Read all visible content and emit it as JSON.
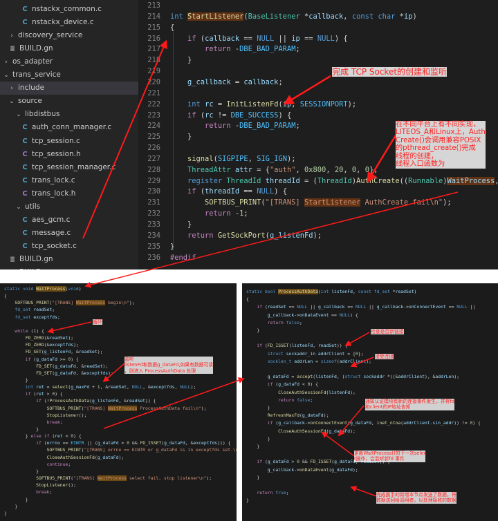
{
  "sidebar": {
    "items": [
      {
        "label": "nstackx_common.c",
        "icon": "c-file-icon",
        "glyph": "C",
        "kind": "c"
      },
      {
        "label": "nstackx_device.c",
        "icon": "c-file-icon",
        "glyph": "C",
        "kind": "c"
      },
      {
        "label": "discovery_service",
        "icon": "chevron-right-icon",
        "glyph": "›",
        "kind": "folder"
      },
      {
        "label": "BUILD.gn",
        "icon": "gn-file-icon",
        "glyph": "≣",
        "kind": "gn"
      },
      {
        "label": "os_adapter",
        "icon": "chevron-right-icon",
        "glyph": "›",
        "kind": "folder"
      },
      {
        "label": "trans_service",
        "icon": "chevron-down-icon",
        "glyph": "⌄",
        "kind": "folder"
      },
      {
        "label": "include",
        "icon": "chevron-right-icon",
        "glyph": "›",
        "kind": "folder"
      },
      {
        "label": "source",
        "icon": "chevron-down-icon",
        "glyph": "⌄",
        "kind": "folder"
      },
      {
        "label": "libdistbus",
        "icon": "chevron-down-icon",
        "glyph": "⌄",
        "kind": "folder"
      },
      {
        "label": "auth_conn_manager.c",
        "icon": "c-file-icon",
        "glyph": "C",
        "kind": "c"
      },
      {
        "label": "tcp_session.c",
        "icon": "c-file-icon",
        "glyph": "C",
        "kind": "c"
      },
      {
        "label": "tcp_session.h",
        "icon": "h-file-icon",
        "glyph": "C",
        "kind": "h"
      },
      {
        "label": "tcp_session_manager.c",
        "icon": "c-file-icon",
        "glyph": "C",
        "kind": "c"
      },
      {
        "label": "trans_lock.c",
        "icon": "c-file-icon",
        "glyph": "C",
        "kind": "c"
      },
      {
        "label": "trans_lock.h",
        "icon": "h-file-icon",
        "glyph": "C",
        "kind": "h"
      },
      {
        "label": "utils",
        "icon": "chevron-down-icon",
        "glyph": "⌄",
        "kind": "folder"
      },
      {
        "label": "aes_gcm.c",
        "icon": "c-file-icon",
        "glyph": "C",
        "kind": "c"
      },
      {
        "label": "message.c",
        "icon": "c-file-icon",
        "glyph": "C",
        "kind": "c"
      },
      {
        "label": "tcp_socket.c",
        "icon": "c-file-icon",
        "glyph": "C",
        "kind": "c"
      },
      {
        "label": "BUILD.gn",
        "icon": "gn-file-icon",
        "glyph": "≣",
        "kind": "gn"
      },
      {
        "label": "BUILD.gn",
        "icon": "gn-file-icon",
        "glyph": "≣",
        "kind": "gn"
      }
    ]
  },
  "editor": {
    "lines": [
      {
        "num": "213",
        "text": ""
      },
      {
        "num": "214",
        "text": "int StartListener(BaseListener *callback, const char *ip)"
      },
      {
        "num": "215",
        "text": "{"
      },
      {
        "num": "216",
        "text": "    if (callback == NULL || ip == NULL) {"
      },
      {
        "num": "217",
        "text": "        return -DBE_BAD_PARAM;"
      },
      {
        "num": "218",
        "text": "    }"
      },
      {
        "num": "219",
        "text": ""
      },
      {
        "num": "220",
        "text": "    g_callback = callback;"
      },
      {
        "num": "221",
        "text": ""
      },
      {
        "num": "222",
        "text": "    int rc = InitListenFd(ip, SESSIONPORT);"
      },
      {
        "num": "223",
        "text": "    if (rc != DBE_SUCCESS) {"
      },
      {
        "num": "224",
        "text": "        return -DBE_BAD_PARAM;"
      },
      {
        "num": "225",
        "text": "    }"
      },
      {
        "num": "226",
        "text": ""
      },
      {
        "num": "227",
        "text": "    signal(SIGPIPE, SIG_IGN);"
      },
      {
        "num": "228",
        "text": "    ThreadAttr attr = {\"auth\", 0x800, 20, 0, 0};"
      },
      {
        "num": "229",
        "text": "    register ThreadId threadId = (ThreadId)AuthCreate((Runnable)WaitProcess, &attr);"
      },
      {
        "num": "230",
        "text": "    if (threadId == NULL) {"
      },
      {
        "num": "231",
        "text": "        SOFTBUS_PRINT(\"[TRANS] StartListener AuthCreate fail\\n\");"
      },
      {
        "num": "232",
        "text": "        return -1;"
      },
      {
        "num": "233",
        "text": "    }"
      },
      {
        "num": "234",
        "text": "    return GetSockPort(g_listenFd);"
      },
      {
        "num": "235",
        "text": "}"
      },
      {
        "num": "236",
        "text": "#endif"
      }
    ]
  },
  "annotations": {
    "tcp_socket": "完成 TCP Socket的创建和监听",
    "platform": "在不同平台上有不同实现，\nLITEOS_A和Linux上，Auth\nCreate()会调用兼容POSIX\n的pthread_create()完成\n线程的创建，\n线程入口函数为",
    "loop": "循环",
    "select": "监听\nlistenFd和数据g_dataFd,如果有数据可读\n，则进入 ProcessAuthData 处理",
    "check_new": "检查是否新链接",
    "accept": "接受连接",
    "notify": "通知认证模块有新的连接事件发生，并将fd\n和client的IP地址告知",
    "refresh": "更新WaitProcess()的下一次seler\nt操作，会监听新fd 事件",
    "data_event": "完成握手的新增本节点发送了数据，将\n数据送回给调用者，以处理接收的数据"
  },
  "wait_process": {
    "lines": [
      "static void WaitProcess(void)",
      "{",
      "    SOFTBUS_PRINT(\"[TRANS] WaitProcess begin\\n\");",
      "    fd_set readSet;",
      "    fd_set exceptfds;",
      "",
      "    while (1) {",
      "        FD_ZERO(&readSet);",
      "        FD_ZERO(&exceptfds);",
      "        FD_SET(g_listenFd, &readSet);",
      "        if (g_dataFd >= 0) {",
      "            FD_SET(g_dataFd, &readSet);",
      "            FD_SET(g_dataFd, &exceptfds);",
      "        }",
      "        int ret = select(g_maxFd + 1, &readSet, NULL, &exceptfds, NULL);",
      "        if (ret > 0) {",
      "            if (!ProcessAuthData(g_listenFd, &readSet)) {",
      "                SOFTBUS_PRINT(\"[TRANS] WaitProcess ProcessAuthData fail\\n\");",
      "                StopListener();",
      "                break;",
      "            }",
      "        } else if (ret < 0) {",
      "            if (errno == EINTR || (g_dataFd > 0 && FD_ISSET(g_dataFd, &exceptfds))) {",
      "                SOFTBUS_PRINT(\"[TRANS] errno == EINTR or g_dataFd is in exceptfds set.\\n\");",
      "                CloseAuthSessionFd(g_dataFd);",
      "                continue;",
      "            }",
      "            SOFTBUS_PRINT(\"[TRANS] WaitProcess select fail, stop listener\\n\");",
      "            StopListener();",
      "            break;",
      "        }",
      "    }",
      "}"
    ]
  },
  "process_auth": {
    "lines": [
      "static bool ProcessAuthData(int listenFd, const fd_set *readSet)",
      "{",
      "    if (readSet == NULL || g_callback == NULL || g_callback->onConnectEvent == NULL ||",
      "        g_callback->onDataEvent == NULL) {",
      "        return false;",
      "    }",
      "",
      "    if (FD_ISSET(listenFd, readSet)) {",
      "        struct sockaddr_in addrClient = {0};",
      "        socklen_t addrLen = sizeof(addrClient);",
      "",
      "        g_dataFd = accept(listenFd, (struct sockaddr *)(&addrClient), &addrLen);",
      "        if (g_dataFd < 0) {",
      "            CloseAuthSessionFd(listenFd);",
      "            return false;",
      "        }",
      "        RefreshMaxFd(g_dataFd);",
      "        if (g_callback->onConnectEvent(g_dataFd, inet_ntoa(addrClient.sin_addr)) != 0) {",
      "            CloseAuthSessionFd(g_dataFd);",
      "        }",
      "    }",
      "",
      "    if (g_dataFd > 0 && FD_ISSET(g_dataFd, readSet)) {",
      "        g_callback->onDataEvent(g_dataFd);",
      "    }",
      "",
      "    return true;",
      "}"
    ]
  }
}
